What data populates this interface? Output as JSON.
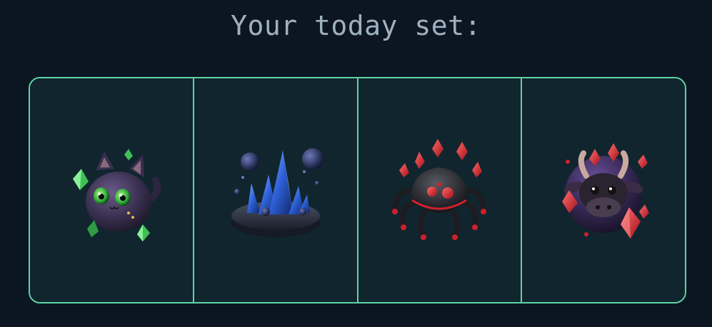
{
  "header": {
    "title": "Your today set:"
  },
  "set": {
    "items": [
      {
        "icon": "cat-creature-icon"
      },
      {
        "icon": "crystal-cluster-icon"
      },
      {
        "icon": "spider-creature-icon"
      },
      {
        "icon": "bull-creature-icon"
      }
    ]
  },
  "colors": {
    "background": "#0b1622",
    "panel": "#11252f",
    "border": "#5fd3a3",
    "title": "#9fb0c0"
  }
}
